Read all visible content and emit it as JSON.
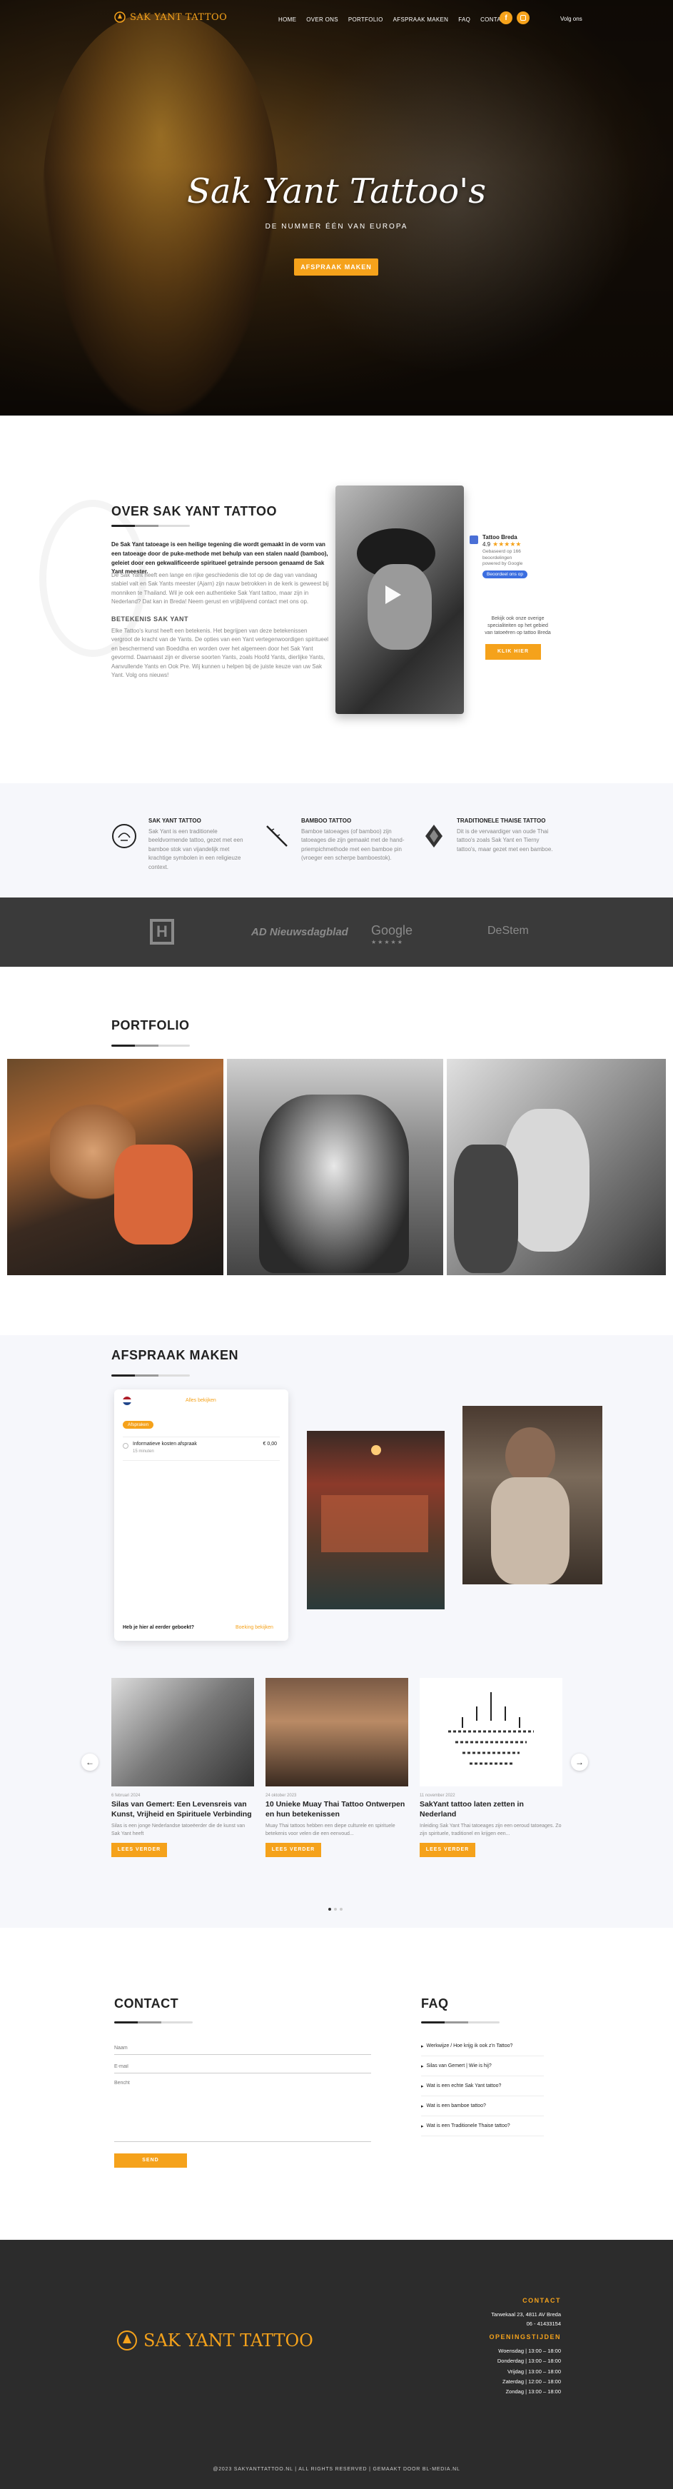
{
  "header": {
    "logo_text": "SAK YANT TATTOO",
    "nav": [
      "HOME",
      "OVER ONS",
      "PORTFOLIO",
      "AFSPRAAK MAKEN",
      "FAQ",
      "CONTACT"
    ],
    "lang": "Volg ons"
  },
  "hero": {
    "title": "Sak Yant Tattoo's",
    "subtitle": "DE NUMMER ÉÉN VAN EUROPA",
    "cta": "AFSPRAAK MAKEN"
  },
  "about": {
    "title": "OVER SAK YANT TATTOO",
    "intro": "De Sak Yant tatoeage is een heilige tegening die wordt gemaakt in de vorm van een tatoeage door de puke-methode met behulp van een stalen naald (bamboo), geleiet door een gekwalificeerde spiritueel getrainde persoon genaamd de Sak Yant meester.",
    "body1": "De Sak Yant heeft een lange en rijke geschiedenis die tot op de dag van vandaag stabiel valt en Sak Yants meester (Ajarn) zijn nauw betrokken in de kerk is geweest bij monniken te Thailand. Wil je ook een authentieke Sak Yant tattoo, maar zijn in Nederland? Dat kan in Breda! Neem gerust en vrijblijvend contact met ons op.",
    "subheading": "BETEKENIS SAK YANT",
    "body2": "Elke Tattoo's kunst heeft een betekenis. Het begrijpen van deze betekenissen vergroot de kracht van de Yants. De opties van een Yant vertegenwoordigen spiritueel en beschermend van Boeddha en worden over het algemeen door het Sak Yant gevormd. Daarnaast zijn er diverse soorten Yants, zoals Hoofd Yants, dierlijke Yants, Aanvullende Yants en Ook Pre. Wij kunnen u helpen bij de juiste keuze van uw Sak Yant. Volg ons nieuws!",
    "review": {
      "business": "Tattoo Breda",
      "rating": "4.9",
      "stars": "★★★★★",
      "count": "Gebaseerd op 166 beoordelingen",
      "powered": "powered by Google",
      "button": "Beoordeel ons op",
      "cta_text": "Bekijk ook onze overige specialiteiten op het gebied van tatoeëren op tattoo Breda",
      "cta": "KLIK HIER"
    }
  },
  "features": [
    {
      "title": "SAK YANT TATTOO",
      "text": "Sak Yant is een traditionele beeldvormende tattoo, gezet met een bamboe stok van vijandelijk met krachtige symbolen in een religieuze context."
    },
    {
      "title": "BAMBOO TATTOO",
      "text": "Bamboe tatoeages (of bamboo) zijn tatoeages die zijn gemaakt met de hand-priempichmethode met een bamboe pin (vroeger een scherpe bamboestok)."
    },
    {
      "title": "TRADITIONELE THAISE TATTOO",
      "text": "Dit is de vervaardiger van oude Thai tattoo's zoals Sak Yant en Tierny tattoo's, maar gezet met een bamboe."
    }
  ],
  "partners": [
    "H",
    "AD Nieuwsdagblad",
    "Google",
    "DeStem"
  ],
  "portfolio": {
    "title": "PORTFOLIO"
  },
  "appointment": {
    "title": "AFSPRAAK MAKEN",
    "widget": {
      "header": "Alles bekijken",
      "tab": "Afspraken",
      "item": "Informatieve kosten afspraak",
      "item_sub": "15 minuten",
      "price": "€ 0,00",
      "footer_q": "Heb je hier al eerder geboekt?",
      "footer_link": "Boeking bekijken"
    }
  },
  "blog": [
    {
      "date": "6 februari 2024",
      "title": "Silas van Gemert: Een Levensreis van Kunst, Vrijheid en Spirituele Verbinding",
      "text": "Silas is een jonge Nederlandse tatoeëerder die de kunst van Sak Yant heeft",
      "cta": "LEES VERDER"
    },
    {
      "date": "24 oktober 2023",
      "title": "10 Unieke Muay Thai Tattoo Ontwerpen en hun betekenissen",
      "text": "Muay Thai tattoos hebben een diepe culturele en spirituele betekenis voor velen die een eenvoud...",
      "cta": "LEES VERDER"
    },
    {
      "date": "11 november 2022",
      "title": "SakYant tattoo laten zetten in Nederland",
      "text": "Inleiding Sak Yant Thai tatoeages zijn een oeroud tatoeages. Zo zijn spirituele, traditionel en krijgen een...",
      "cta": "LEES VERDER"
    }
  ],
  "contact": {
    "title": "CONTACT",
    "name_ph": "Naam",
    "email_ph": "E-mail",
    "msg_ph": "Bericht",
    "send": "SEND"
  },
  "faq": {
    "title": "FAQ",
    "items": [
      "Werkwijze / Hoe krijg ik ook z'n Tattoo?",
      "Silas van Gemert | Wie is hij?",
      "Wat is een echte Sak Yant tattoo?",
      "Wat is een bamboe tattoo?",
      "Wat is een Traditionele Thaise tattoo?"
    ]
  },
  "footer": {
    "logo_text": "SAK YANT TATTOO",
    "contact_title": "CONTACT",
    "address": "Tarwekaal 23, 4811 AV Breda",
    "phone": "06 - 41433154",
    "hours_title": "OPENINGSTIJDEN",
    "hours": [
      "Woensdag | 13:00 – 18:00",
      "Donderdag | 13:00 – 18:00",
      "Vrijdag | 13:00 – 18:00",
      "Zaterdag | 12:00 – 18:00",
      "Zondag | 13:00 – 18:00"
    ],
    "copyright": "@2023 SAKYANTTATTOO.NL | ALL RIGHTS RESERVED | GEMAAKT DOOR BL-MEDIA.NL"
  },
  "colors": {
    "accent": "#f5a21b",
    "dark": "#222222",
    "light_bg": "#f7f8fb"
  }
}
